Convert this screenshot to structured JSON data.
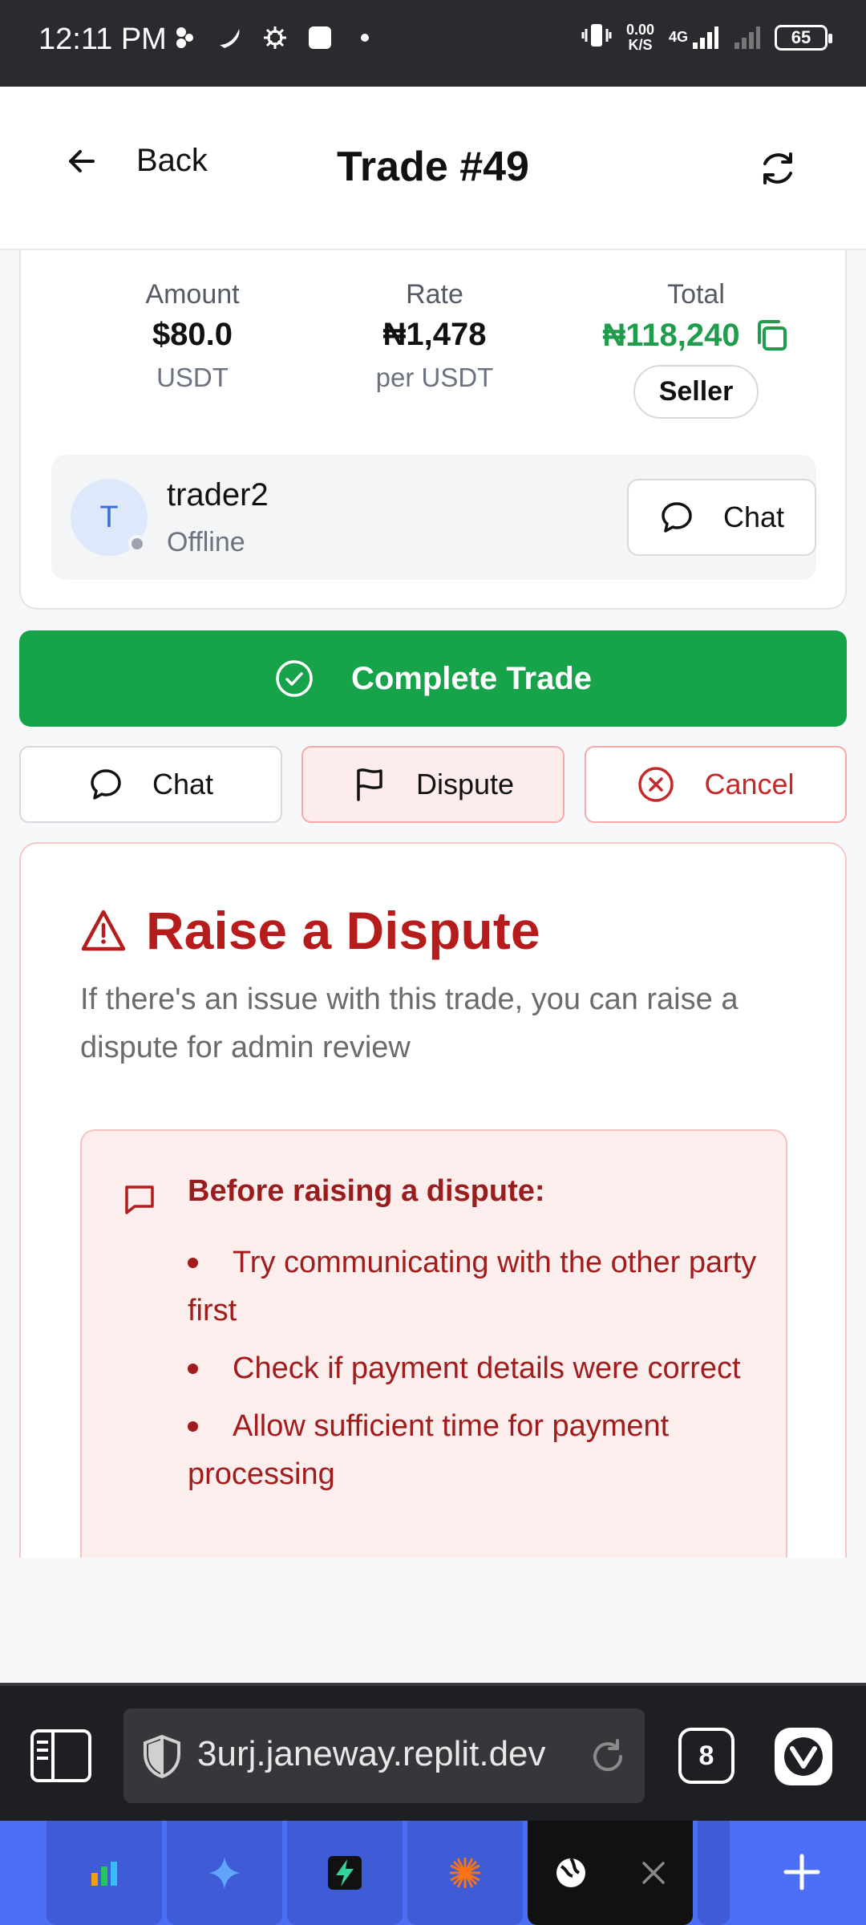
{
  "statusbar": {
    "time": "12:11 PM",
    "speed_value": "0.00",
    "speed_unit": "K/S",
    "network": "4G",
    "battery": "65"
  },
  "header": {
    "back_label": "Back",
    "title": "Trade #49"
  },
  "trade": {
    "amount_label": "Amount",
    "amount_value": "$80.0",
    "amount_unit": "USDT",
    "rate_label": "Rate",
    "rate_value": "₦1,478",
    "rate_unit": "per USDT",
    "total_label": "Total",
    "total_value": "₦118,240",
    "role_badge": "Seller"
  },
  "counterparty": {
    "avatar_initial": "T",
    "username": "trader2",
    "status": "Offline",
    "chat_label": "Chat"
  },
  "actions": {
    "complete_label": "Complete Trade",
    "chat_label": "Chat",
    "dispute_label": "Dispute",
    "cancel_label": "Cancel"
  },
  "dispute": {
    "title": "Raise a Dispute",
    "description": "If there's an issue with this trade, you can raise a dispute for admin review",
    "info_title": "Before raising a dispute:",
    "tips": [
      "Try communicating with the other party first",
      "Check if payment details were correct",
      "Allow sufficient time for payment processing"
    ]
  },
  "browser": {
    "url": "3urj.janeway.replit.dev",
    "tab_count": "8"
  },
  "colors": {
    "success": "#16a34a",
    "danger": "#b71c1c",
    "taskbar": "#4c6ef5"
  }
}
